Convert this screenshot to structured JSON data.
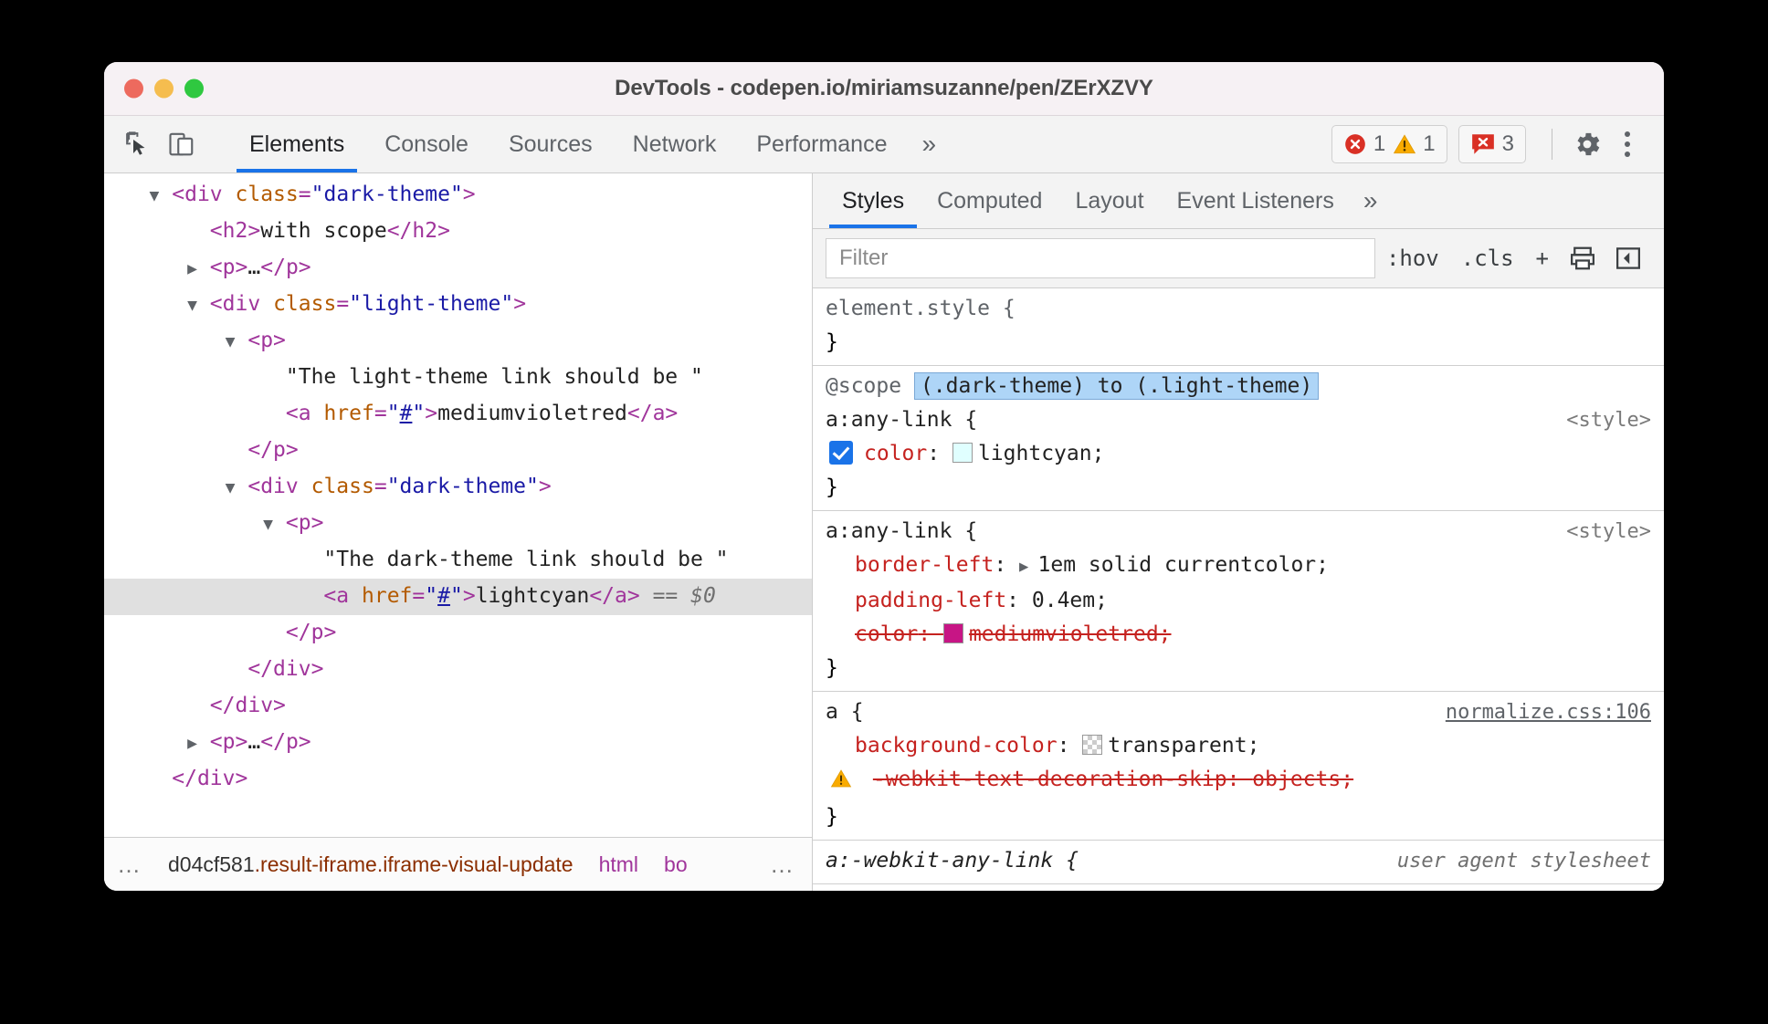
{
  "window": {
    "title": "DevTools - codepen.io/miriamsuzanne/pen/ZErXZVY"
  },
  "toolbar": {
    "tabs": [
      {
        "label": "Elements",
        "active": true
      },
      {
        "label": "Console",
        "active": false
      },
      {
        "label": "Sources",
        "active": false
      },
      {
        "label": "Network",
        "active": false
      },
      {
        "label": "Performance",
        "active": false
      }
    ],
    "more_label": "»",
    "badges": {
      "errors": "1",
      "warnings": "1",
      "issues": "3"
    },
    "inspect_icon": "cursor-select-icon",
    "device_icon": "device-toolbar-icon",
    "settings_icon": "gear-icon",
    "menu_icon": "kebab-menu-icon"
  },
  "dom_tree": {
    "rows": [
      {
        "indent": 0,
        "toggle": "open",
        "selected": false,
        "parts": [
          {
            "t": "punct",
            "s": "<"
          },
          {
            "t": "tag",
            "s": "div"
          },
          {
            "t": "txt",
            "s": " "
          },
          {
            "t": "attr",
            "s": "class"
          },
          {
            "t": "punct",
            "s": "="
          },
          {
            "t": "val",
            "s": "\"dark-theme\""
          },
          {
            "t": "punct",
            "s": ">"
          }
        ]
      },
      {
        "indent": 1,
        "toggle": "none",
        "selected": false,
        "parts": [
          {
            "t": "punct",
            "s": "<"
          },
          {
            "t": "tag",
            "s": "h2"
          },
          {
            "t": "punct",
            "s": ">"
          },
          {
            "t": "txt",
            "s": "with scope"
          },
          {
            "t": "punct",
            "s": "</"
          },
          {
            "t": "tag",
            "s": "h2"
          },
          {
            "t": "punct",
            "s": ">"
          }
        ]
      },
      {
        "indent": 1,
        "toggle": "closed",
        "selected": false,
        "parts": [
          {
            "t": "punct",
            "s": "<"
          },
          {
            "t": "tag",
            "s": "p"
          },
          {
            "t": "punct",
            "s": ">"
          },
          {
            "t": "txt",
            "s": "…"
          },
          {
            "t": "punct",
            "s": "</"
          },
          {
            "t": "tag",
            "s": "p"
          },
          {
            "t": "punct",
            "s": ">"
          }
        ]
      },
      {
        "indent": 1,
        "toggle": "open",
        "selected": false,
        "parts": [
          {
            "t": "punct",
            "s": "<"
          },
          {
            "t": "tag",
            "s": "div"
          },
          {
            "t": "txt",
            "s": " "
          },
          {
            "t": "attr",
            "s": "class"
          },
          {
            "t": "punct",
            "s": "="
          },
          {
            "t": "val",
            "s": "\"light-theme\""
          },
          {
            "t": "punct",
            "s": ">"
          }
        ]
      },
      {
        "indent": 2,
        "toggle": "open",
        "selected": false,
        "parts": [
          {
            "t": "punct",
            "s": "<"
          },
          {
            "t": "tag",
            "s": "p"
          },
          {
            "t": "punct",
            "s": ">"
          }
        ]
      },
      {
        "indent": 3,
        "toggle": "none",
        "selected": false,
        "parts": [
          {
            "t": "txt",
            "s": "\"The light-theme link should be \""
          }
        ]
      },
      {
        "indent": 3,
        "toggle": "none",
        "selected": false,
        "parts": [
          {
            "t": "punct",
            "s": "<"
          },
          {
            "t": "tag",
            "s": "a"
          },
          {
            "t": "txt",
            "s": " "
          },
          {
            "t": "attr",
            "s": "href"
          },
          {
            "t": "punct",
            "s": "="
          },
          {
            "t": "val",
            "s": "\""
          },
          {
            "t": "link",
            "s": "#"
          },
          {
            "t": "val",
            "s": "\""
          },
          {
            "t": "punct",
            "s": ">"
          },
          {
            "t": "txt",
            "s": "mediumvioletred"
          },
          {
            "t": "punct",
            "s": "</"
          },
          {
            "t": "tag",
            "s": "a"
          },
          {
            "t": "punct",
            "s": ">"
          }
        ]
      },
      {
        "indent": 2,
        "toggle": "none",
        "selected": false,
        "parts": [
          {
            "t": "punct",
            "s": "</"
          },
          {
            "t": "tag",
            "s": "p"
          },
          {
            "t": "punct",
            "s": ">"
          }
        ]
      },
      {
        "indent": 2,
        "toggle": "open",
        "selected": false,
        "parts": [
          {
            "t": "punct",
            "s": "<"
          },
          {
            "t": "tag",
            "s": "div"
          },
          {
            "t": "txt",
            "s": " "
          },
          {
            "t": "attr",
            "s": "class"
          },
          {
            "t": "punct",
            "s": "="
          },
          {
            "t": "val",
            "s": "\"dark-theme\""
          },
          {
            "t": "punct",
            "s": ">"
          }
        ]
      },
      {
        "indent": 3,
        "toggle": "open",
        "selected": false,
        "parts": [
          {
            "t": "punct",
            "s": "<"
          },
          {
            "t": "tag",
            "s": "p"
          },
          {
            "t": "punct",
            "s": ">"
          }
        ]
      },
      {
        "indent": 4,
        "toggle": "none",
        "selected": false,
        "parts": [
          {
            "t": "txt",
            "s": "\"The dark-theme link should be \""
          }
        ]
      },
      {
        "indent": 4,
        "toggle": "none",
        "selected": true,
        "parts": [
          {
            "t": "punct",
            "s": "<"
          },
          {
            "t": "tag",
            "s": "a"
          },
          {
            "t": "txt",
            "s": " "
          },
          {
            "t": "attr",
            "s": "href"
          },
          {
            "t": "punct",
            "s": "="
          },
          {
            "t": "val",
            "s": "\""
          },
          {
            "t": "link",
            "s": "#"
          },
          {
            "t": "val",
            "s": "\""
          },
          {
            "t": "punct",
            "s": ">"
          },
          {
            "t": "txt",
            "s": "lightcyan"
          },
          {
            "t": "punct",
            "s": "</"
          },
          {
            "t": "tag",
            "s": "a"
          },
          {
            "t": "punct",
            "s": ">"
          },
          {
            "t": "dollar",
            "s": " == $0"
          }
        ]
      },
      {
        "indent": 3,
        "toggle": "none",
        "selected": false,
        "parts": [
          {
            "t": "punct",
            "s": "</"
          },
          {
            "t": "tag",
            "s": "p"
          },
          {
            "t": "punct",
            "s": ">"
          }
        ]
      },
      {
        "indent": 2,
        "toggle": "none",
        "selected": false,
        "parts": [
          {
            "t": "punct",
            "s": "</"
          },
          {
            "t": "tag",
            "s": "div"
          },
          {
            "t": "punct",
            "s": ">"
          }
        ]
      },
      {
        "indent": 1,
        "toggle": "none",
        "selected": false,
        "parts": [
          {
            "t": "punct",
            "s": "</"
          },
          {
            "t": "tag",
            "s": "div"
          },
          {
            "t": "punct",
            "s": ">"
          }
        ]
      },
      {
        "indent": 1,
        "toggle": "closed",
        "selected": false,
        "parts": [
          {
            "t": "punct",
            "s": "<"
          },
          {
            "t": "tag",
            "s": "p"
          },
          {
            "t": "punct",
            "s": ">"
          },
          {
            "t": "txt",
            "s": "…"
          },
          {
            "t": "punct",
            "s": "</"
          },
          {
            "t": "tag",
            "s": "p"
          },
          {
            "t": "punct",
            "s": ">"
          }
        ]
      },
      {
        "indent": 0,
        "toggle": "none",
        "selected": false,
        "parts": [
          {
            "t": "punct",
            "s": "</"
          },
          {
            "t": "tag",
            "s": "div"
          },
          {
            "t": "punct",
            "s": ">"
          }
        ]
      }
    ]
  },
  "breadcrumb": {
    "leading_ellipsis": "…",
    "items": [
      {
        "node": "d04cf581",
        "classes": ".result-iframe.iframe-visual-update",
        "kind": "node"
      },
      {
        "node": "html",
        "classes": "",
        "kind": "tag"
      },
      {
        "node": "bo",
        "classes": "",
        "kind": "tag"
      }
    ],
    "trailing_ellipsis": "…"
  },
  "styles_pane": {
    "tabs": [
      {
        "label": "Styles",
        "active": true
      },
      {
        "label": "Computed",
        "active": false
      },
      {
        "label": "Layout",
        "active": false
      },
      {
        "label": "Event Listeners",
        "active": false
      }
    ],
    "more_label": "»",
    "filter": {
      "placeholder": "Filter",
      "value": ""
    },
    "actions": {
      "hov": ":hov",
      "cls": ".cls",
      "new_rule": "+",
      "print_icon": "print-style-icon",
      "sidebar_icon": "toggle-sidebar-icon"
    },
    "rules": [
      {
        "id": "element-style",
        "selector": "element.style",
        "selector_dim": true,
        "origin": "",
        "origin_kind": "none",
        "scope": null,
        "declarations": []
      },
      {
        "id": "scope-any-link",
        "selector": "a:any-link",
        "selector_dim": false,
        "origin": "<style>",
        "origin_kind": "plain",
        "scope": {
          "at_rule": "@scope",
          "prelude": "(.dark-theme) to (.light-theme)",
          "highlighted": true
        },
        "declarations": [
          {
            "checkbox": true,
            "checked": true,
            "name": "color",
            "value": "lightcyan",
            "swatch": "#e0ffff",
            "swatch_checker": false,
            "struck": false,
            "warning": false,
            "expandable": false
          }
        ]
      },
      {
        "id": "any-link-overridden",
        "selector": "a:any-link",
        "selector_dim": false,
        "origin": "<style>",
        "origin_kind": "plain",
        "scope": null,
        "declarations": [
          {
            "checkbox": false,
            "checked": false,
            "name": "border-left",
            "value": "1em solid currentcolor",
            "swatch": null,
            "swatch_checker": false,
            "struck": false,
            "warning": false,
            "expandable": true
          },
          {
            "checkbox": false,
            "checked": false,
            "name": "padding-left",
            "value": "0.4em",
            "swatch": null,
            "swatch_checker": false,
            "struck": false,
            "warning": false,
            "expandable": false
          },
          {
            "checkbox": false,
            "checked": false,
            "name": "color",
            "value": "mediumvioletred",
            "swatch": "#c71585",
            "swatch_checker": false,
            "struck": true,
            "warning": false,
            "expandable": false
          }
        ]
      },
      {
        "id": "normalize-a",
        "selector": "a",
        "selector_dim": false,
        "origin": "normalize.css:106",
        "origin_kind": "link",
        "scope": null,
        "declarations": [
          {
            "checkbox": false,
            "checked": false,
            "name": "background-color",
            "value": "transparent",
            "swatch": null,
            "swatch_checker": true,
            "struck": false,
            "warning": false,
            "expandable": false
          },
          {
            "checkbox": false,
            "checked": false,
            "name": "-webkit-text-decoration-skip",
            "value": "objects",
            "swatch": null,
            "swatch_checker": false,
            "struck": true,
            "warning": true,
            "expandable": false
          }
        ]
      },
      {
        "id": "ua-any-link",
        "selector": "a:-webkit-any-link",
        "selector_dim": false,
        "selector_italic": true,
        "origin": "user agent stylesheet",
        "origin_kind": "ua",
        "scope": null,
        "declarations": []
      }
    ]
  },
  "colors": {
    "accent": "#1a73e8",
    "error": "#d93025",
    "warning": "#f9ab00",
    "property": "#c5221f",
    "tag": "#a0359b",
    "attr": "#b35a00",
    "attr_value": "#1a1aa6",
    "selection": "#aed5f7"
  }
}
